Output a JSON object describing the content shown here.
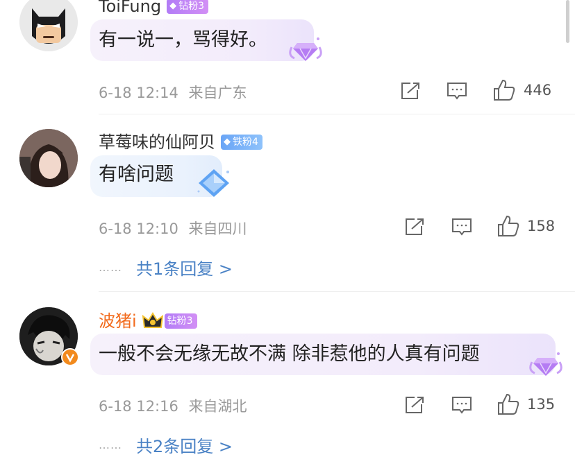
{
  "comments": [
    {
      "username": "ToiFung",
      "badge": "钻粉3",
      "text": "有一说一，骂得好。",
      "time": "6-18 12:14",
      "location": "来自广东",
      "likes": "446"
    },
    {
      "username": "草莓味的仙阿贝",
      "badge": "铁粉4",
      "text": "有啥问题",
      "time": "6-18 12:10",
      "location": "来自四川",
      "likes": "158",
      "reply_dots": "……",
      "reply_link": "共1条回复 >"
    },
    {
      "username": "波猪i",
      "badge": "钻粉3",
      "text": "一般不会无缘无故不满 除非惹他的人真有问题",
      "time": "6-18 12:16",
      "location": "来自湖北",
      "likes": "135",
      "reply_dots": "……",
      "reply_link": "共2条回复 >"
    }
  ],
  "icons": {
    "share": "share-icon",
    "comment": "comment-icon",
    "like": "thumbs-up-icon",
    "badge_gem": "◆"
  },
  "colors": {
    "link": "#4a82c5",
    "vip_name": "#f26b1d",
    "meta": "#999999"
  }
}
